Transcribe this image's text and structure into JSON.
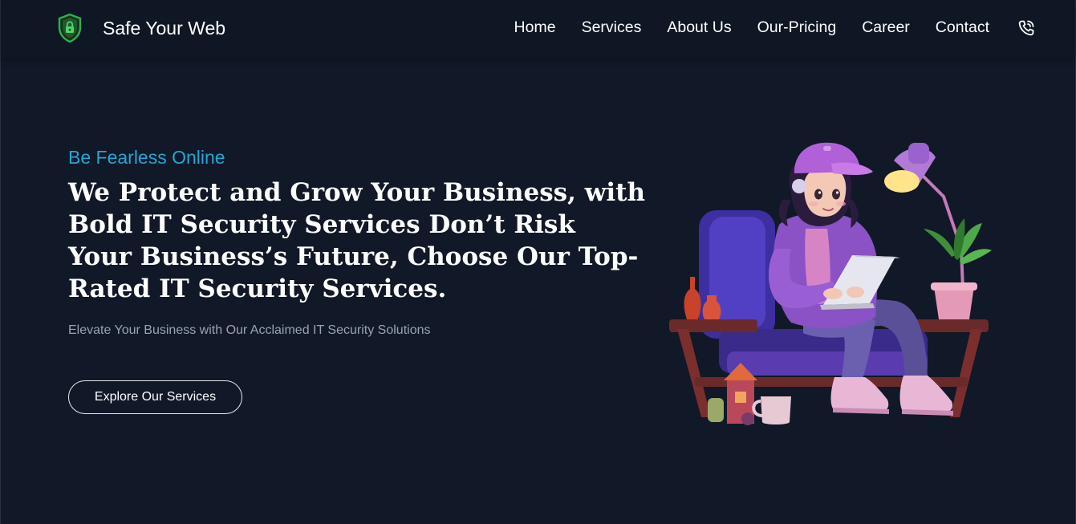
{
  "brand": {
    "name": "Safe Your Web",
    "logo_icon": "shield-lock-icon",
    "logo_color": "#2fb04a"
  },
  "nav": {
    "items": [
      {
        "label": "Home"
      },
      {
        "label": "Services"
      },
      {
        "label": "About Us"
      },
      {
        "label": "Our-Pricing"
      },
      {
        "label": "Career"
      },
      {
        "label": "Contact"
      }
    ],
    "phone_icon": "phone-call-icon"
  },
  "hero": {
    "eyebrow": "Be Fearless Online",
    "headline": "We Protect and Grow Your Business, with Bold IT Security Services Don’t Risk Your Business’s Future, Choose Our Top-Rated IT Security Services.",
    "subtext": "Elevate Your Business with Our Acclaimed IT Security Solutions",
    "cta_label": "Explore Our Services",
    "illustration": "girl-with-laptop-illustration"
  },
  "colors": {
    "background": "#111827",
    "navbar": "#0f1624",
    "accent": "#22a7d6",
    "text": "#ffffff",
    "muted": "#9aa3b2"
  }
}
